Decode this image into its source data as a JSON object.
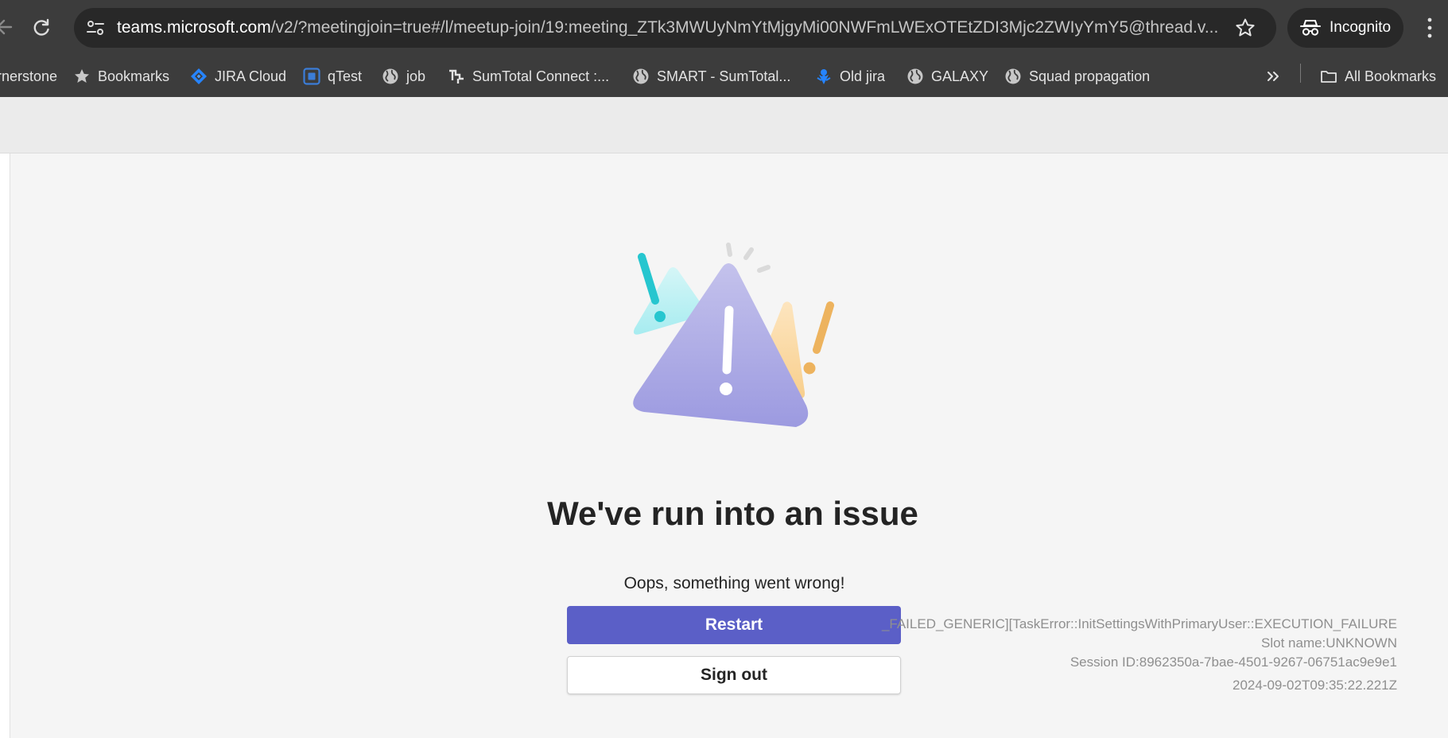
{
  "browser": {
    "url_host": "teams.microsoft.com",
    "url_rest": "/v2/?meetingjoin=true#/l/meetup-join/19:meeting_ZTk3MWUyNmYtMjgyMi00NWFmLWExOTEtZDI3Mjc2ZWIyYmY5@thread.v...",
    "incognito_label": "Incognito",
    "bookmarks": [
      {
        "label": "rnerstone",
        "icon": "none"
      },
      {
        "label": "Bookmarks",
        "icon": "star-icon"
      },
      {
        "label": "JIRA Cloud",
        "icon": "jira-icon"
      },
      {
        "label": "qTest",
        "icon": "qtest-icon"
      },
      {
        "label": "job",
        "icon": "globe-icon"
      },
      {
        "label": "SumTotal Connect :...",
        "icon": "sumtotal-icon"
      },
      {
        "label": "SMART - SumTotal...",
        "icon": "globe-icon"
      },
      {
        "label": "Old jira",
        "icon": "old-jira-icon"
      },
      {
        "label": "GALAXY",
        "icon": "globe-icon"
      },
      {
        "label": "Squad propagation",
        "icon": "globe-icon"
      }
    ],
    "all_bookmarks_label": "All Bookmarks"
  },
  "error": {
    "title": "We've run into an issue",
    "message": "Oops, something went wrong!",
    "restart_label": "Restart",
    "signout_label": "Sign out",
    "diagnostics": [
      "_FAILED_GENERIC][TaskError::InitSettingsWithPrimaryUser::EXECUTION_FAILURE",
      "Slot name:UNKNOWN",
      "Session ID:8962350a-7bae-4501-9267-06751ac9e9e1",
      "2024-09-02T09:35:22.221Z"
    ]
  },
  "colors": {
    "primary_button": "#5b5fc7",
    "chrome_bar": "#3c3c3c",
    "page_background": "#f5f5f5"
  }
}
